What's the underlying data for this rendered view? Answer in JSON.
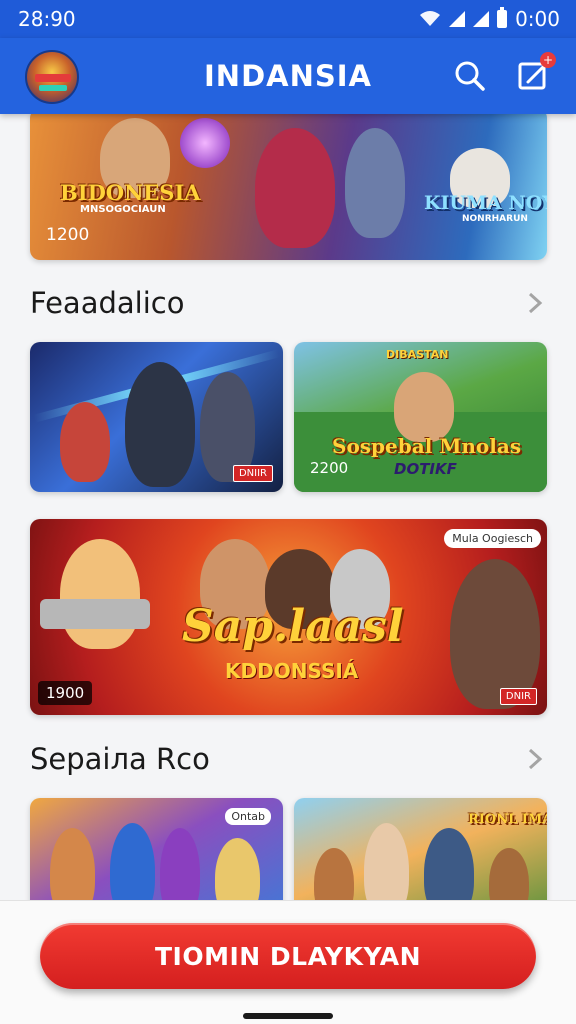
{
  "status_bar": {
    "time": "28:90",
    "battery": "0:00",
    "icons": [
      "wifi-icon",
      "signal-icon",
      "signal-icon",
      "battery-icon"
    ]
  },
  "app_bar": {
    "title": "INDANSIA",
    "icons": [
      "app-logo",
      "search-icon",
      "edit-icon"
    ],
    "notification_badge": "+"
  },
  "hero_banner": {
    "title": "BIDONESIA",
    "subtitle": "MNSOGOCIAUN",
    "right_title": "KIUMA NOY",
    "right_subtitle": "NONRHARUN",
    "badge": "1200"
  },
  "section1": {
    "title": "Feaadalico",
    "cards": [
      {
        "tag": "DNIIR",
        "badge": ""
      },
      {
        "top_label": "DIBASTAN",
        "title": "Sospebal Mnolas",
        "subtitle": "DOTIKF",
        "badge": "2200"
      }
    ]
  },
  "feature_banner": {
    "title": "Sap.laasl",
    "subtitle": "KDDONSSIÁ",
    "top_right_label": "Mula Oogiesch",
    "badge": "1900",
    "tag": "DNIR"
  },
  "section2": {
    "title": "Sepaiла Rco",
    "cards": [
      {
        "tag": "Ontab"
      },
      {
        "title": "RIONL IMALUE"
      }
    ]
  },
  "cta": {
    "label": "TIOMIN DLAYKYAN"
  },
  "colors": {
    "primary": "#2463df",
    "status_bar": "#1f5bd8",
    "cta": "#e12a27",
    "background": "#f4f5f7"
  }
}
